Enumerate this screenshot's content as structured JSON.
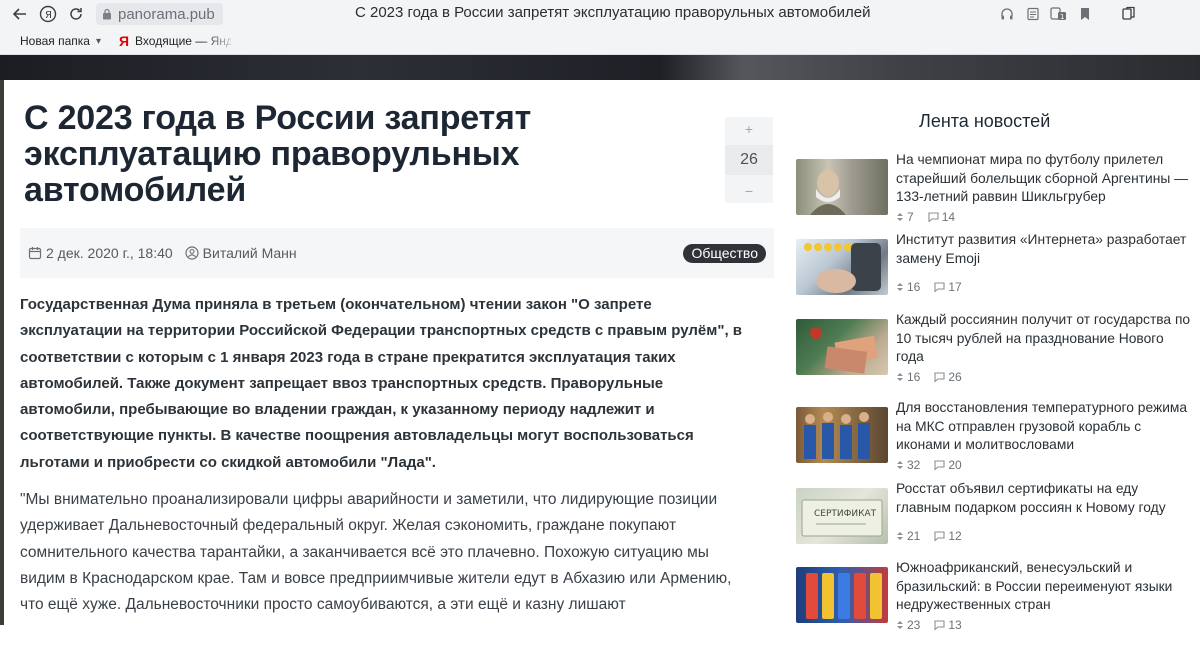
{
  "browser": {
    "url": "panorama.pub",
    "page_title": "С 2023 года в России запретят эксплуатацию праворульных автомобилей",
    "bookmarks": [
      {
        "label": "Новая папка"
      },
      {
        "label": "Входящие — Яндекс"
      }
    ]
  },
  "article": {
    "title": "С 2023 года в России запретят эксплуатацию праворульных автомобилей",
    "rating": "26",
    "vote_plus": "+",
    "vote_minus": "−",
    "date": "2 дек. 2020 г., 18:40",
    "author": "Виталий Манн",
    "tag": "Общество",
    "lead": "Государственная Дума приняла в третьем (окончательном) чтении закон \"О запрете эксплуатации на территории Российской Федерации транспортных средств с правым рулём\", в соответствии с которым с 1 января 2023 года в стране прекратится эксплуатация таких автомобилей. Также документ запрещает ввоз транспортных средств. Праворульные автомобили, пребывающие во владении граждан, к указанному периоду надлежит и соответствующие пункты. В качестве поощрения автовладельцы могут воспользоваться льготами и приобрести со скидкой автомобили \"Лада\".",
    "paragraph": "\"Мы внимательно проанализировали цифры аварийности и заметили, что лидирующие позиции удерживает Дальневосточный федеральный округ. Желая сэкономить, граждане покупают сомнительного качества тарантайки, а заканчивается всё это плачевно. Похожую ситуацию мы видим в Краснодарском крае. Там и вовсе предприимчивые жители едут в Абхазию или Армению, что ещё хуже. Дальневосточники просто самоубиваются, а эти ещё и казну лишают"
  },
  "sidebar": {
    "heading": "Лента новостей",
    "items": [
      {
        "title": "На чемпионат мира по футболу прилетел старейший болельщик сборной Аргентины — 133-летний раввин Шикльгрубер",
        "rating": "7",
        "comments": "14"
      },
      {
        "title": "Институт развития «Интернета» разработает замену Emoji",
        "rating": "16",
        "comments": "17"
      },
      {
        "title": "Каждый россиянин получит от государства по 10 тысяч рублей на празднование Нового года",
        "rating": "16",
        "comments": "26"
      },
      {
        "title": "Для восстановления температурного режима на МКС отправлен грузовой корабль с иконами и молитвословами",
        "rating": "32",
        "comments": "20"
      },
      {
        "title": "Росстат объявил сертификаты на еду главным подарком россиян к Новому году",
        "rating": "21",
        "comments": "12"
      },
      {
        "title": "Южноафриканский, венесуэльский и бразильский: в России переименуют языки недружественных стран",
        "rating": "23",
        "comments": "13"
      }
    ]
  },
  "colors": {
    "tag_bg": "#2f3338",
    "title_text": "#1d2733"
  }
}
